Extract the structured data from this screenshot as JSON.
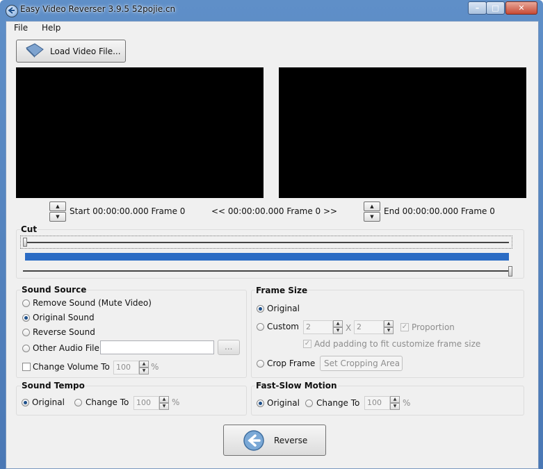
{
  "window": {
    "title": "Easy Video Reverser 3.9.5 52pojie.cn",
    "app_icon": "back-arrow-icon"
  },
  "menu": {
    "items": [
      "File",
      "Help"
    ]
  },
  "toolbar": {
    "load_label": "Load Video File...",
    "load_icon": "book-icon"
  },
  "timeline": {
    "start_text": "Start 00:00:00.000 Frame 0",
    "current_text": "<< 00:00:00.000  Frame 0 >>",
    "end_text": "End 00:00:00.000  Frame 0"
  },
  "cut": {
    "title": "Cut",
    "start_position": 0,
    "end_position": 1,
    "accent": "#2b6cc4"
  },
  "sound_source": {
    "title": "Sound Source",
    "options": [
      "Remove Sound (Mute Video)",
      "Original Sound",
      "Reverse Sound",
      "Other Audio File"
    ],
    "selected": "Original Sound",
    "other_file_value": "",
    "browse_label": "...",
    "change_volume_label": "Change Volume To",
    "volume_value": "100",
    "volume_unit": "%"
  },
  "frame_size": {
    "title": "Frame Size",
    "original_label": "Original",
    "custom_label": "Custom",
    "width_value": "2",
    "height_value": "2",
    "x_label": "X",
    "proportion_label": "Proportion",
    "padding_label": "Add padding to fit customize frame size",
    "crop_label": "Crop Frame",
    "crop_button": "Set Cropping Area",
    "selected": "Original"
  },
  "sound_tempo": {
    "title": "Sound Tempo",
    "original_label": "Original",
    "change_label": "Change To",
    "value": "100",
    "unit": "%",
    "selected": "Original"
  },
  "fast_slow": {
    "title": "Fast-Slow Motion",
    "original_label": "Original",
    "change_label": "Change To",
    "value": "100",
    "unit": "%",
    "selected": "Original"
  },
  "reverse_button": {
    "label": "Reverse",
    "icon": "back-arrow-icon"
  }
}
